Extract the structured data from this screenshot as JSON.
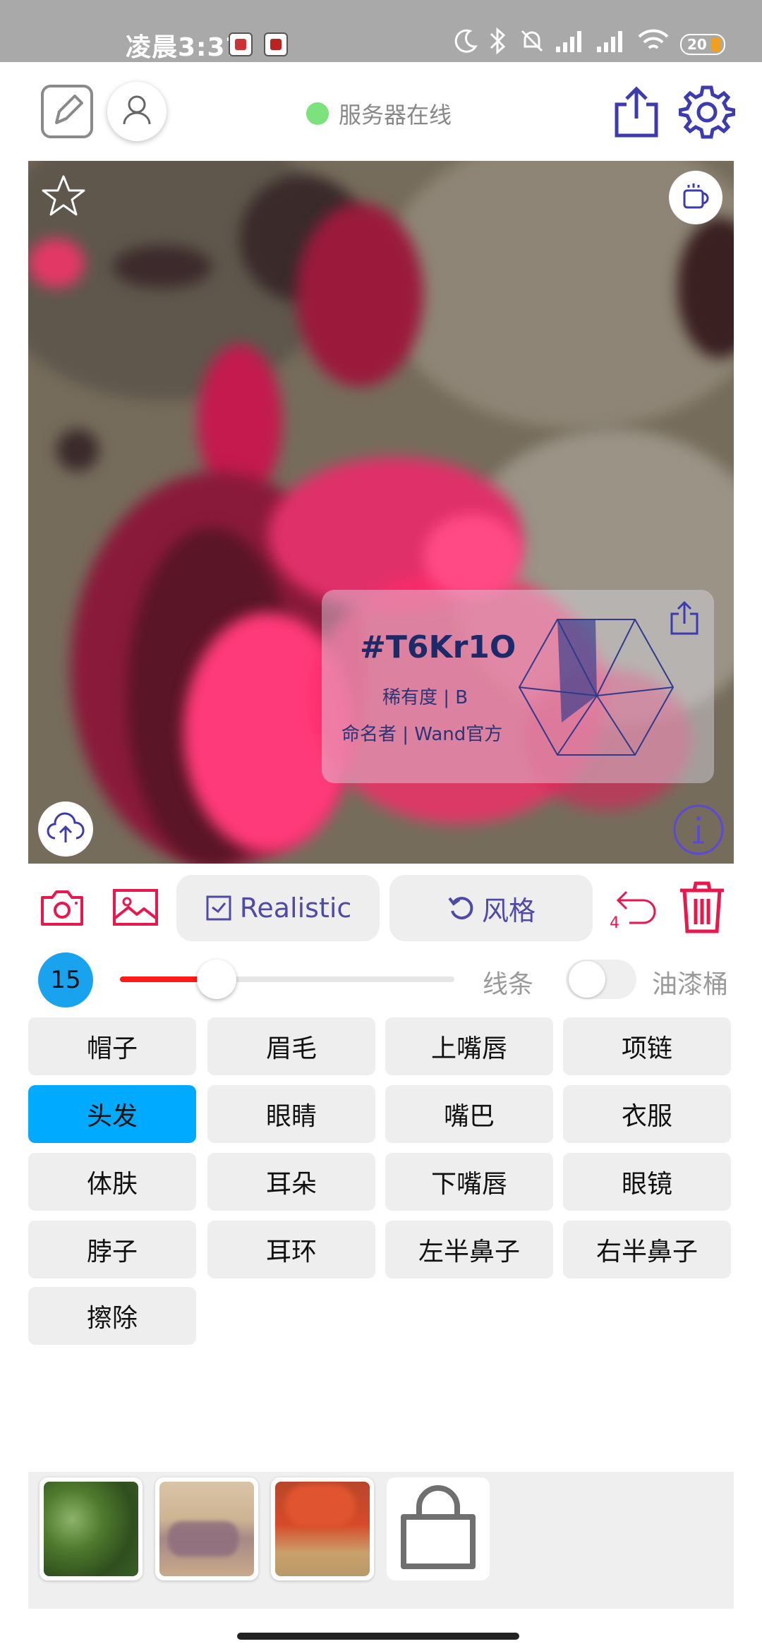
{
  "status_bar": {
    "time": "凌晨3:37",
    "battery": "20",
    "icons": [
      "moon-icon",
      "bluetooth-icon",
      "mute-icon",
      "signal-icon",
      "signal-icon",
      "wifi-icon",
      "battery-icon"
    ]
  },
  "topbar": {
    "server_status": "服务器在线",
    "status_color": "#7ce27c",
    "icons": [
      "edit-icon",
      "user-icon",
      "share-icon",
      "settings-icon"
    ]
  },
  "canvas": {
    "card": {
      "id": "#T6Kr1O",
      "rarity": "稀有度 | B",
      "namer": "命名者 | Wand官方"
    },
    "icons": [
      "star-icon",
      "coffee-cup-icon",
      "cloud-upload-icon",
      "info-icon",
      "share-icon"
    ]
  },
  "toolbar": {
    "realistic_label": "Realistic",
    "style_label": "风格",
    "undo_count": "4",
    "icons": [
      "camera-icon",
      "image-icon",
      "checkbox-icon",
      "undo-icon",
      "trash-icon"
    ]
  },
  "brush": {
    "size": "15",
    "level": 0.29,
    "lines_label": "线条",
    "bucket_label": "油漆桶",
    "bucket_enabled": false
  },
  "categories": [
    {
      "label": "帽子"
    },
    {
      "label": "眉毛"
    },
    {
      "label": "上嘴唇"
    },
    {
      "label": "项链"
    },
    {
      "label": "头发"
    },
    {
      "label": "眼睛"
    },
    {
      "label": "嘴巴"
    },
    {
      "label": "衣服"
    },
    {
      "label": "体肤"
    },
    {
      "label": "耳朵"
    },
    {
      "label": "下嘴唇"
    },
    {
      "label": "眼镜"
    },
    {
      "label": "脖子"
    },
    {
      "label": "耳环"
    },
    {
      "label": "左半鼻子"
    },
    {
      "label": "右半鼻子"
    },
    {
      "label": "擦除"
    }
  ],
  "selected_category": "头发",
  "colors": {
    "accent": "#4e4aa8",
    "danger": "#e8174d",
    "selected": "#00aaff",
    "slider": "#ff1a1a"
  }
}
